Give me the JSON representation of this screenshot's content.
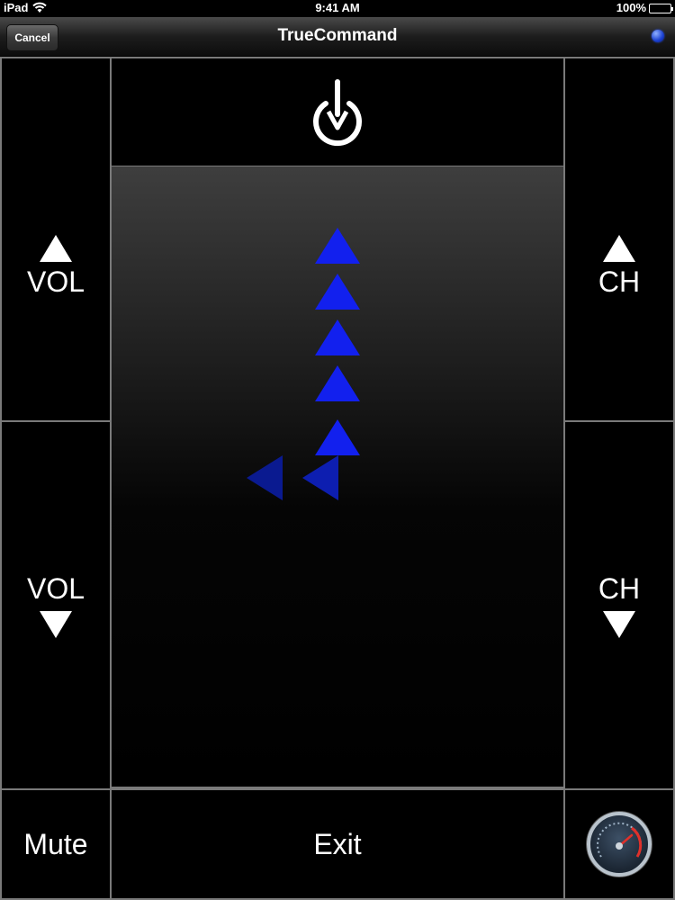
{
  "status_bar": {
    "carrier": "iPad",
    "time": "9:41 AM",
    "battery": "100%",
    "battery_level": 1.0
  },
  "nav": {
    "cancel_label": "Cancel",
    "title": "TrueCommand",
    "status_color": "#2a4ee0"
  },
  "remote": {
    "power_icon": "power-icon",
    "vol_up": "VOL",
    "vol_down": "VOL",
    "ch_up": "CH",
    "ch_down": "CH",
    "mute": "Mute",
    "exit": "Exit",
    "speed_icon": "speedometer-icon"
  },
  "gesture_trail": {
    "up_arrows": 5,
    "left_arrows": 2,
    "color": "#1220ee"
  }
}
